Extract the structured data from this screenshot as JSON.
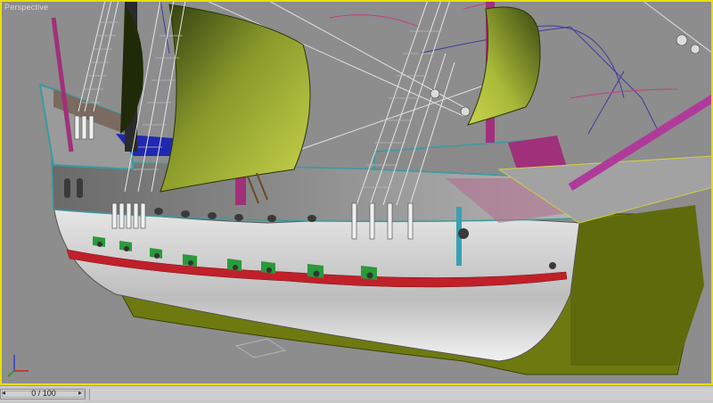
{
  "viewport": {
    "label": "Perspective",
    "border_color": "#e8e000",
    "background": "#8d8d8d"
  },
  "scene": {
    "subject": "3D galleon ship model",
    "colors": {
      "hull": "#d8d8d8",
      "keel": "#6e7a10",
      "stripe": "#c0202a",
      "sail": "#b8c440",
      "mast": "#a0307a",
      "deck_accent": "#a0307a",
      "blue_deck": "#2028b0",
      "rigging": "#e0e0e0",
      "cannon_port": "#2a9a3a"
    }
  },
  "timeline": {
    "frame_display": "0 / 100",
    "current_frame": 0,
    "total_frames": 100
  },
  "icons": {
    "axis": "axis-tripod-icon",
    "prev": "arrow-left-icon",
    "next": "arrow-right-icon"
  }
}
